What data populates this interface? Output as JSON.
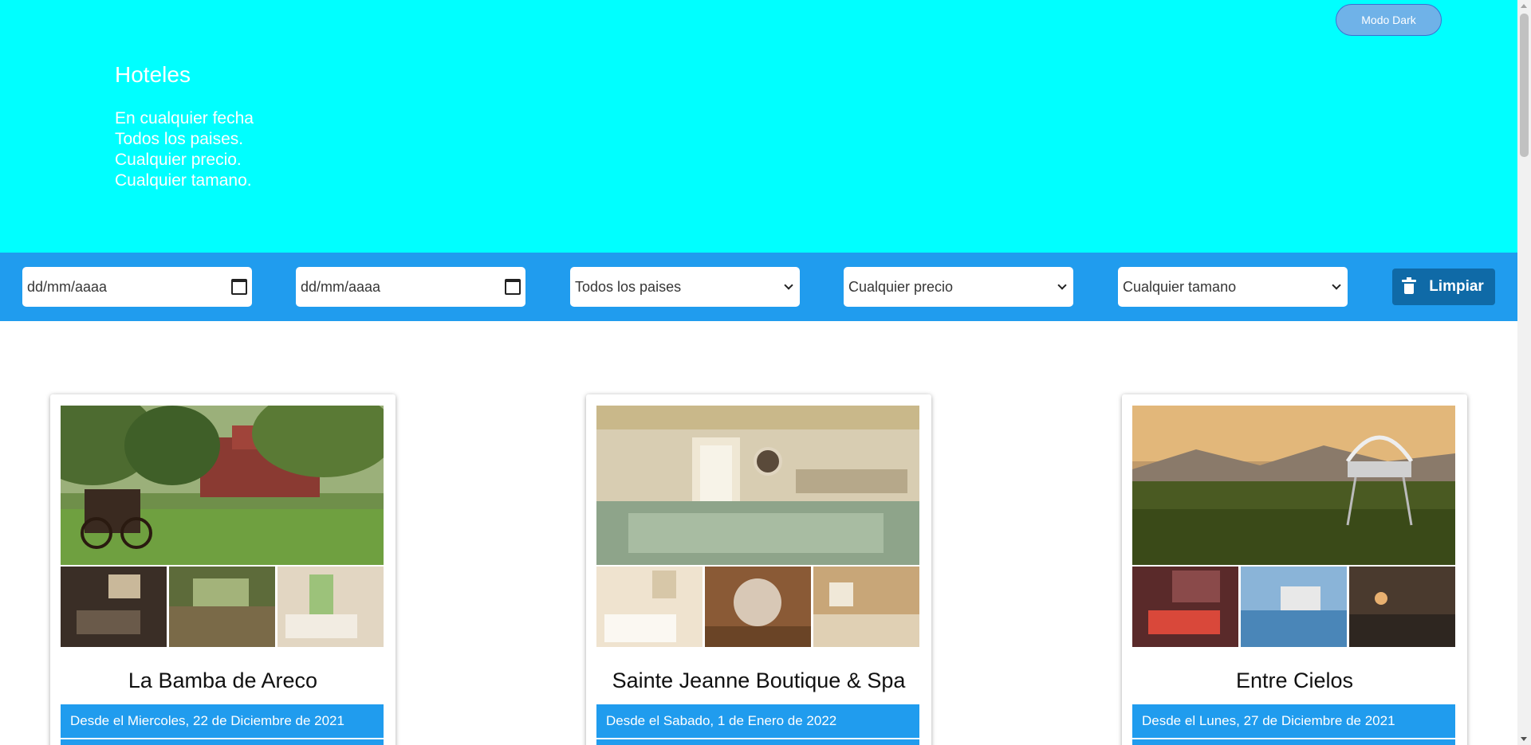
{
  "header": {
    "dark_mode_label": "Modo Dark",
    "title": "Hoteles",
    "subtitle_lines": [
      "En cualquier fecha",
      "Todos los paises.",
      "Cualquier precio.",
      "Cualquier tamano."
    ]
  },
  "filters": {
    "date_from": "dd/mm/aaaa",
    "date_to": "dd/mm/aaaa",
    "country_select": "Todos los paises",
    "price_select": "Cualquier precio",
    "size_select": "Cualquier tamano",
    "clear_label": "Limpiar"
  },
  "hotels": [
    {
      "name": "La Bamba de Areco",
      "date": "Desde el Miercoles, 22 de Diciembre de 2021"
    },
    {
      "name": "Sainte Jeanne Boutique & Spa",
      "date": "Desde el Sabado, 1 de Enero de 2022"
    },
    {
      "name": "Entre Cielos",
      "date": "Desde el Lunes, 27 de Diciembre de 2021"
    }
  ],
  "colors": {
    "hero_bg": "#00ffff",
    "filter_bar": "#209cee",
    "clear_button": "#0f6aa7",
    "dark_button": "#6fb2e8"
  }
}
